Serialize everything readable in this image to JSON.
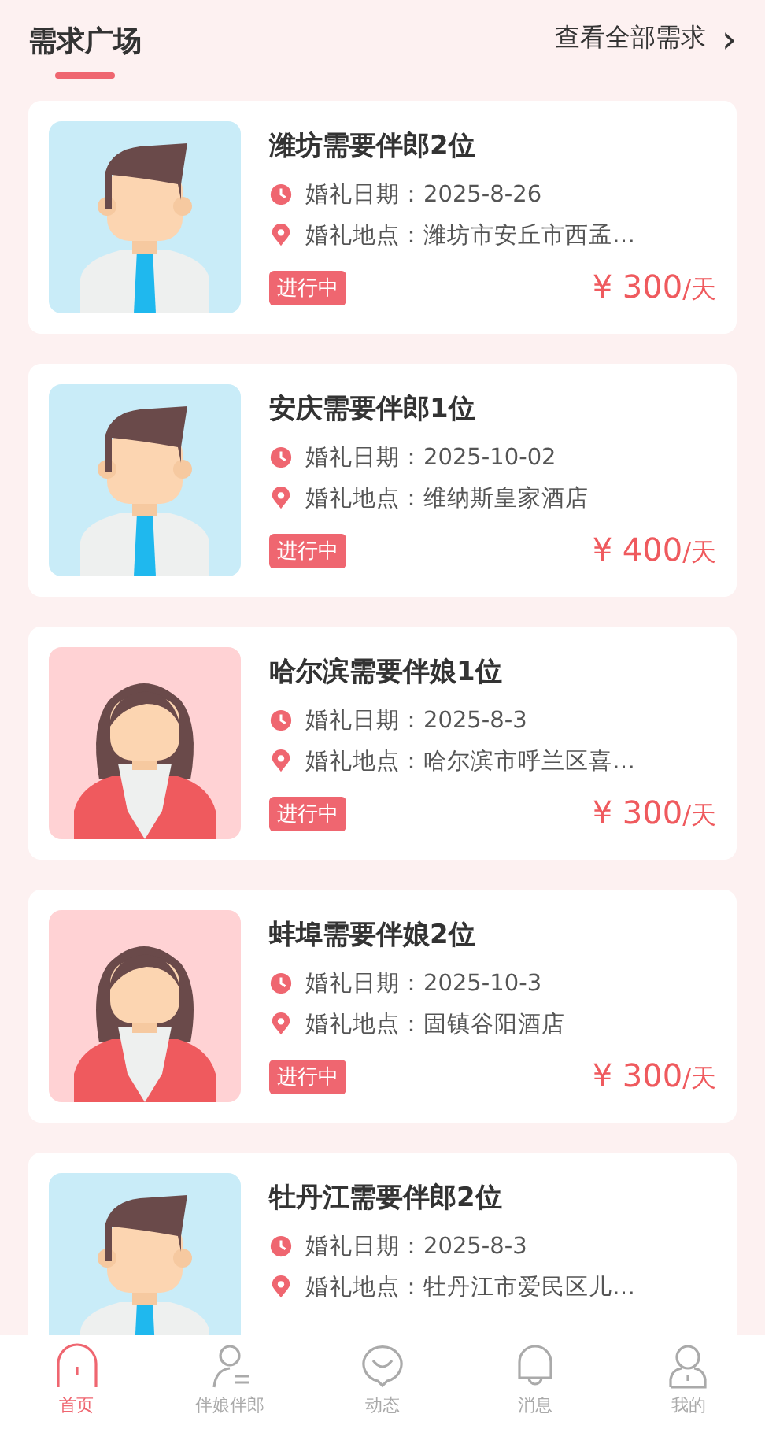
{
  "header": {
    "title": "需求广场",
    "more_link": "查看全部需求",
    "more_arrow": "›"
  },
  "demands": [
    {
      "kind": "man",
      "title": "潍坊需要伴郎2位",
      "date": "婚礼日期：2025-8-26",
      "place": "婚礼地点：潍坊市安丘市西孟…",
      "status": "进行中",
      "price": "¥ 300",
      "unit": "/天"
    },
    {
      "kind": "man",
      "title": "安庆需要伴郎1位",
      "date": "婚礼日期：2025-10-02",
      "place": "婚礼地点：维纳斯皇家酒店",
      "status": "进行中",
      "price": "¥ 400",
      "unit": "/天"
    },
    {
      "kind": "woman",
      "title": "哈尔滨需要伴娘1位",
      "date": "婚礼日期：2025-8-3",
      "place": "婚礼地点：哈尔滨市呼兰区喜…",
      "status": "进行中",
      "price": "¥ 300",
      "unit": "/天"
    },
    {
      "kind": "woman",
      "title": "蚌埠需要伴娘2位",
      "date": "婚礼日期：2025-10-3",
      "place": "婚礼地点：固镇谷阳酒店",
      "status": "进行中",
      "price": "¥ 300",
      "unit": "/天"
    },
    {
      "kind": "man",
      "title": "牡丹江需要伴郎2位",
      "date": "婚礼日期：2025-8-3",
      "place": "婚礼地点：牡丹江市爱民区儿…"
    }
  ],
  "tab_bar": [
    {
      "kind": "home",
      "label": "首页",
      "selected": true
    },
    {
      "kind": "partner",
      "label": "伴娘伴郎",
      "selected": false
    },
    {
      "kind": "moments",
      "label": "动态",
      "selected": false
    },
    {
      "kind": "messages",
      "label": "消息",
      "selected": false
    },
    {
      "kind": "mine",
      "label": "我的",
      "selected": false
    }
  ]
}
